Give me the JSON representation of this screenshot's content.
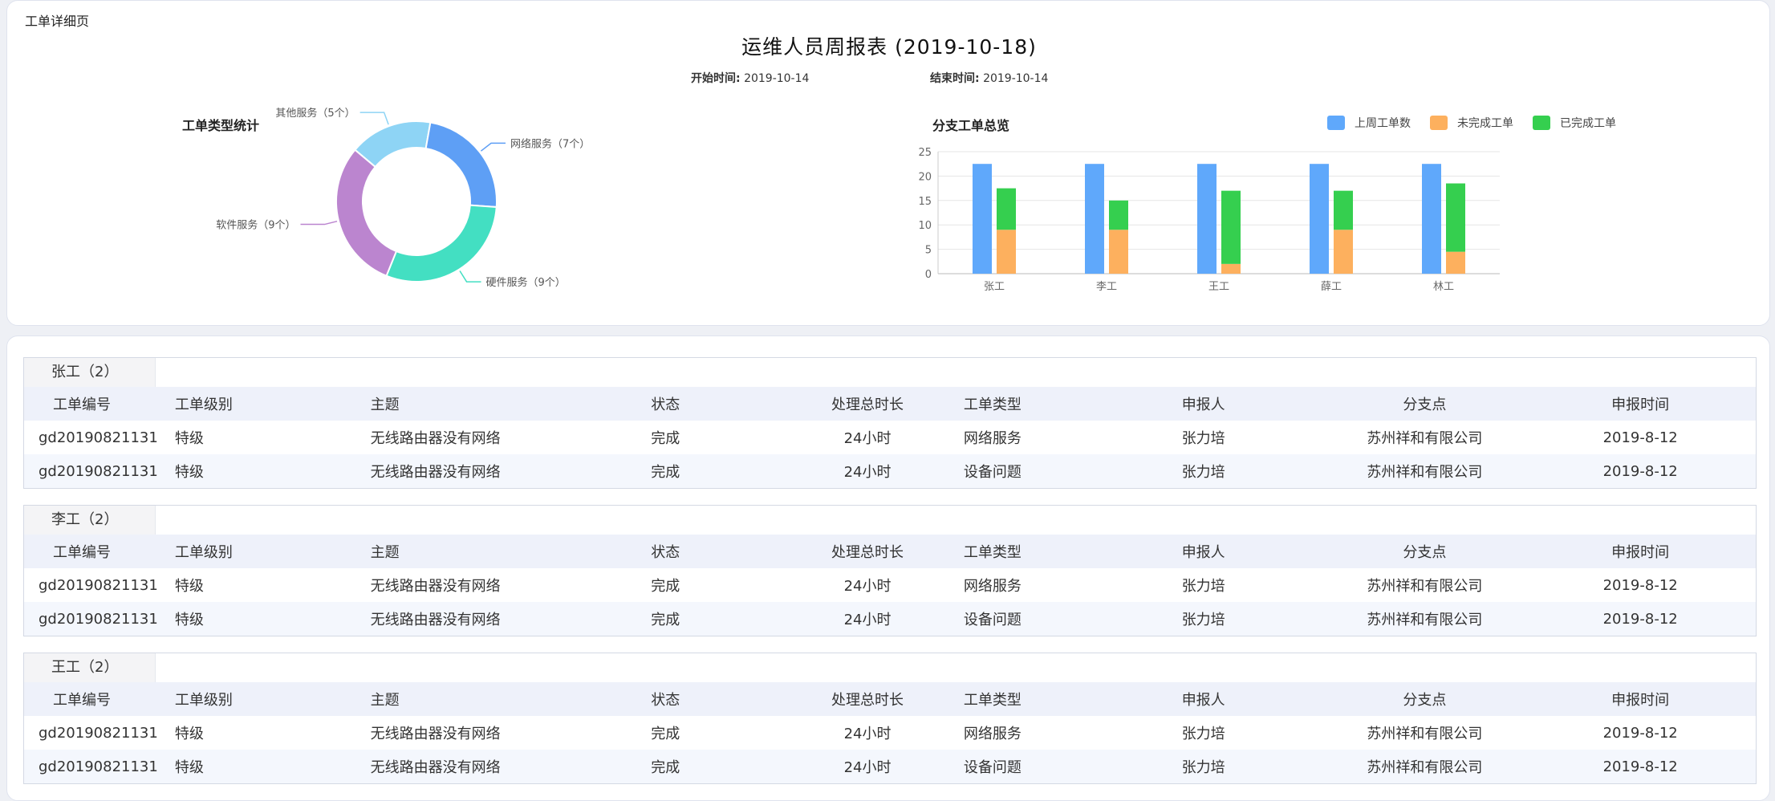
{
  "page": {
    "breadcrumb": "工单详细页",
    "report_title": "运维人员周报表 (2019-10-18)",
    "start_label": "开始时间:",
    "start_value": "2019-10-14",
    "end_label": "结束时间:",
    "end_value": "2019-10-14"
  },
  "chart_data": [
    {
      "type": "pie",
      "title": "工单类型统计",
      "labels": [
        "其他服务（5个）",
        "网络服务（7个）",
        "硬件服务（9个）",
        "软件服务（9个）"
      ],
      "categories": [
        "其他服务",
        "网络服务",
        "硬件服务",
        "软件服务"
      ],
      "values": [
        5,
        7,
        9,
        9
      ],
      "colors": [
        "#8ed4f5",
        "#5e9ff5",
        "#43dfc2",
        "#bb85cf"
      ]
    },
    {
      "type": "bar",
      "title": "分支工单总览",
      "categories": [
        "张工",
        "李工",
        "王工",
        "薛工",
        "林工"
      ],
      "ylim": [
        0,
        25
      ],
      "yticks": [
        "0",
        "5",
        "10",
        "15",
        "20",
        "25"
      ],
      "legend_position": "top-right",
      "grid": true,
      "series": [
        {
          "name": "上周工单数",
          "values": [
            22.5,
            22.5,
            22.5,
            22.5,
            22.5
          ],
          "color": "#5fa8fb",
          "stack": "a"
        },
        {
          "name": "未完成工单",
          "values": [
            9,
            9,
            2,
            9,
            4.5
          ],
          "color": "#fdb05e",
          "stack": "b"
        },
        {
          "name": "已完成工单",
          "values": [
            8.5,
            6,
            15,
            8,
            14
          ],
          "color": "#35cf4f",
          "stack": "b"
        }
      ]
    }
  ],
  "table": {
    "headers": [
      "工单编号",
      "工单级别",
      "主题",
      "状态",
      "处理总时长",
      "工单类型",
      "申报人",
      "分支点",
      "申报时间"
    ],
    "groups": [
      {
        "tab": "张工（2）",
        "rows": [
          [
            "gd20190821131",
            "特级",
            "无线路由器没有网络",
            "完成",
            "24小时",
            "网络服务",
            "张力培",
            "苏州祥和有限公司",
            "2019-8-12"
          ],
          [
            "gd20190821131",
            "特级",
            "无线路由器没有网络",
            "完成",
            "24小时",
            "设备问题",
            "张力培",
            "苏州祥和有限公司",
            "2019-8-12"
          ]
        ]
      },
      {
        "tab": "李工（2）",
        "rows": [
          [
            "gd20190821131",
            "特级",
            "无线路由器没有网络",
            "完成",
            "24小时",
            "网络服务",
            "张力培",
            "苏州祥和有限公司",
            "2019-8-12"
          ],
          [
            "gd20190821131",
            "特级",
            "无线路由器没有网络",
            "完成",
            "24小时",
            "设备问题",
            "张力培",
            "苏州祥和有限公司",
            "2019-8-12"
          ]
        ]
      },
      {
        "tab": "王工（2）",
        "rows": [
          [
            "gd20190821131",
            "特级",
            "无线路由器没有网络",
            "完成",
            "24小时",
            "网络服务",
            "张力培",
            "苏州祥和有限公司",
            "2019-8-12"
          ],
          [
            "gd20190821131",
            "特级",
            "无线路由器没有网络",
            "完成",
            "24小时",
            "设备问题",
            "张力培",
            "苏州祥和有限公司",
            "2019-8-12"
          ]
        ]
      }
    ]
  }
}
